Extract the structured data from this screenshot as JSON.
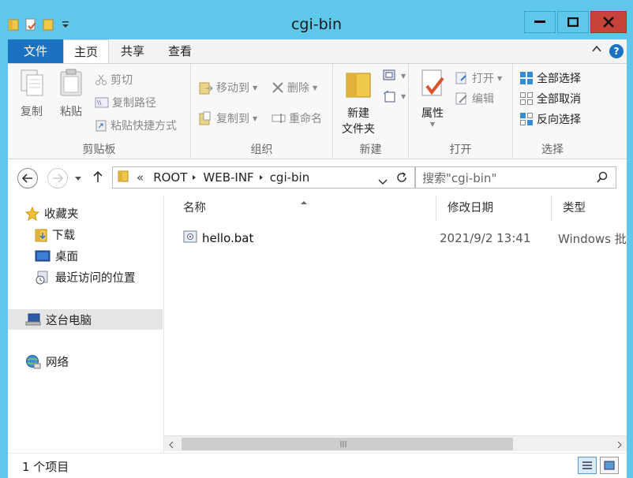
{
  "window": {
    "title": "cgi-bin"
  },
  "tabs": {
    "file": "文件",
    "home": "主页",
    "share": "共享",
    "view": "查看"
  },
  "ribbon": {
    "clipboard": {
      "copy": "复制",
      "paste": "粘贴",
      "cut": "剪切",
      "copy_path": "复制路径",
      "paste_shortcut": "粘贴快捷方式",
      "label": "剪贴板"
    },
    "organize": {
      "move_to": "移动到",
      "copy_to": "复制到",
      "delete": "删除",
      "rename": "重命名",
      "label": "组织"
    },
    "new": {
      "new_folder_line1": "新建",
      "new_folder_line2": "文件夹",
      "label": "新建"
    },
    "open": {
      "properties": "属性",
      "open": "打开",
      "edit": "编辑",
      "label": "打开"
    },
    "select": {
      "select_all": "全部选择",
      "select_none": "全部取消",
      "invert": "反向选择",
      "label": "选择"
    }
  },
  "address": {
    "chevron": "«",
    "crumbs": [
      "ROOT",
      "WEB-INF",
      "cgi-bin"
    ]
  },
  "search": {
    "placeholder": "搜索\"cgi-bin\""
  },
  "nav": {
    "favorites": "收藏夹",
    "downloads": "下载",
    "desktop": "桌面",
    "recent": "最近访问的位置",
    "this_pc": "这台电脑",
    "network": "网络"
  },
  "columns": {
    "name": "名称",
    "modified": "修改日期",
    "type": "类型"
  },
  "files": [
    {
      "name": "hello.bat",
      "modified": "2021/9/2 13:41",
      "type": "Windows 批"
    }
  ],
  "status": {
    "count": "1 个项目"
  },
  "colors": {
    "titlebar": "#5fc8ea",
    "file_tab": "#1b72c2",
    "close": "#c7433a"
  }
}
